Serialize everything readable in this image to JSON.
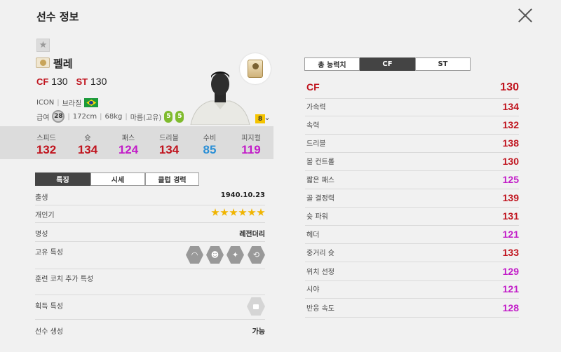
{
  "header": {
    "title": "선수 정보"
  },
  "player": {
    "name": "펠레",
    "positions": [
      {
        "pos": "CF",
        "ovr": "130"
      },
      {
        "pos": "ST",
        "ovr": "130"
      }
    ],
    "season": "ICON",
    "nation": "브라질",
    "salary_label": "급여",
    "salary": "28",
    "height": "172cm",
    "weight": "68kg",
    "body_type": "마름(고유)",
    "left_foot": "5",
    "right_foot": "5",
    "grade": "8"
  },
  "summary_stats": [
    {
      "label": "스피드",
      "value": "132",
      "color": "#c0141e"
    },
    {
      "label": "슛",
      "value": "134",
      "color": "#c0141e"
    },
    {
      "label": "패스",
      "value": "124",
      "color": "#c21cc8"
    },
    {
      "label": "드리블",
      "value": "134",
      "color": "#c0141e"
    },
    {
      "label": "수비",
      "value": "85",
      "color": "#2b8fd6"
    },
    {
      "label": "피지컬",
      "value": "119",
      "color": "#c21cc8"
    }
  ],
  "left_tabs": [
    "특징",
    "시세",
    "클럽 경력"
  ],
  "details": {
    "birth_label": "출생",
    "birth_value": "1940.10.23",
    "personal_label": "개인기",
    "personal_stars": 6,
    "fame_label": "명성",
    "fame_value": "레전더리",
    "traits_label": "고유 특성",
    "coach_label": "훈련 코치 추가 특성",
    "acquire_label": "획득 특성",
    "create_label": "선수 생성",
    "create_value": "가능"
  },
  "right_tabs": [
    "총 능력치",
    "CF",
    "ST"
  ],
  "attributes": [
    {
      "label": "CF",
      "value": "130",
      "color": "#c0141e"
    },
    {
      "label": "가속력",
      "value": "134",
      "color": "#c0141e"
    },
    {
      "label": "속력",
      "value": "132",
      "color": "#c0141e"
    },
    {
      "label": "드리블",
      "value": "138",
      "color": "#c0141e"
    },
    {
      "label": "볼 컨트롤",
      "value": "130",
      "color": "#c0141e"
    },
    {
      "label": "짧은 패스",
      "value": "125",
      "color": "#c21cc8"
    },
    {
      "label": "골 결정력",
      "value": "139",
      "color": "#c0141e"
    },
    {
      "label": "슛 파워",
      "value": "131",
      "color": "#c0141e"
    },
    {
      "label": "헤더",
      "value": "121",
      "color": "#c21cc8"
    },
    {
      "label": "중거리 슛",
      "value": "133",
      "color": "#c0141e"
    },
    {
      "label": "위치 선정",
      "value": "129",
      "color": "#c21cc8"
    },
    {
      "label": "시야",
      "value": "121",
      "color": "#c21cc8"
    },
    {
      "label": "반응 속도",
      "value": "128",
      "color": "#c21cc8"
    }
  ]
}
